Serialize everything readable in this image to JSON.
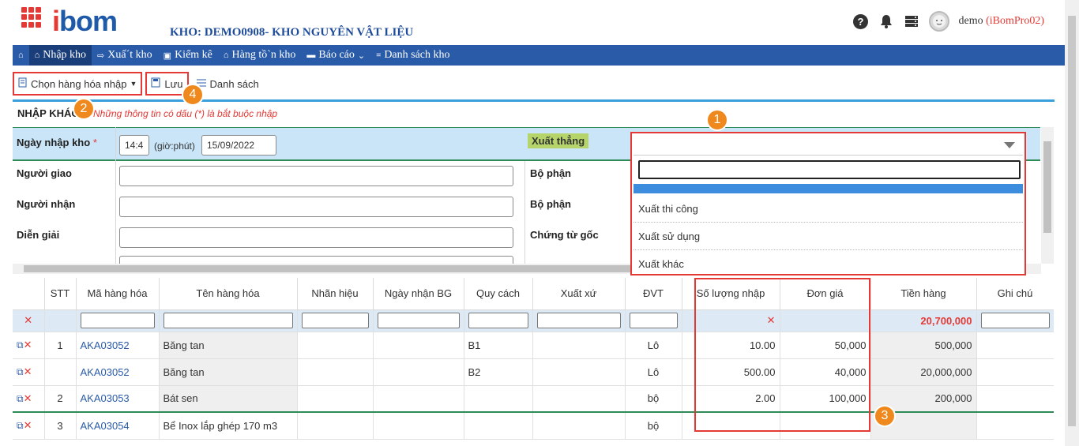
{
  "header": {
    "logo_prefix": "i",
    "logo_main": "bom",
    "kho_title": "KHO: DEMO0908- KHO NGUYÊN VẬT LIỆU",
    "user_name": "demo",
    "user_account": "(iBomPro02)"
  },
  "nav": {
    "items": [
      {
        "label": "Nhập kho"
      },
      {
        "label": "Xuấ´t kho"
      },
      {
        "label": "Kiểm kê"
      },
      {
        "label": "Hàng tồ`n kho"
      },
      {
        "label": "Báo cáo"
      },
      {
        "label": "Danh sách kho"
      }
    ]
  },
  "toolbar": {
    "choose_label": "Chọn hàng hóa nhập",
    "save_label": "Lưu",
    "list_label": "Danh sách"
  },
  "badges": [
    "1",
    "2",
    "3",
    "4"
  ],
  "form": {
    "title": "NHẬP KHÁC",
    "note": "Những thông tin có dấu (*) là bắt buộc nhập",
    "ngay_nhap_label": "Ngày nhập kho",
    "required_mark": "*",
    "time_value": "14:4",
    "time_unit": "(giờ:phút)",
    "date_value": "15/09/2022",
    "xuat_thang_label": "Xuất thẳng",
    "nguoi_giao_label": "Người giao",
    "nguoi_nhan_label": "Người nhận",
    "dien_giai_label": "Diễn giải",
    "bo_phan_label_1": "Bộ phận",
    "bo_phan_label_2": "Bộ phận",
    "chung_tu_label": "Chứng từ gốc"
  },
  "dropdown": {
    "options": [
      "Xuất thi công",
      "Xuất sử dụng",
      "Xuất khác"
    ]
  },
  "table": {
    "headers": [
      "STT",
      "Mã hàng hóa",
      "Tên hàng hóa",
      "Nhãn hiệu",
      "Ngày nhận BG",
      "Quy cách",
      "Xuất xứ",
      "ĐVT",
      "Số lượng nhập",
      "Đơn giá",
      "Tiền hàng",
      "Ghi chú"
    ],
    "total": "20,700,000",
    "rows": [
      {
        "stt": "1",
        "code": "AKA03052",
        "name": "Băng tan",
        "spec": "B1",
        "unit": "Lô",
        "qty": "10.00",
        "price": "50,000",
        "amount": "500,000"
      },
      {
        "stt": "",
        "code": "AKA03052",
        "name": "Băng tan",
        "spec": "B2",
        "unit": "Lô",
        "qty": "500.00",
        "price": "40,000",
        "amount": "20,000,000"
      },
      {
        "stt": "2",
        "code": "AKA03053",
        "name": "Bát sen",
        "spec": "",
        "unit": "bộ",
        "qty": "2.00",
        "price": "100,000",
        "amount": "200,000"
      },
      {
        "stt": "3",
        "code": "AKA03054",
        "name": "Bể Inox lắp ghép 170 m3",
        "spec": "",
        "unit": "bộ",
        "qty": "",
        "price": "",
        "amount": ""
      }
    ]
  },
  "colors": {
    "brand_blue": "#2a5ba8",
    "accent_red": "#e53935",
    "badge_orange": "#f0891d"
  }
}
